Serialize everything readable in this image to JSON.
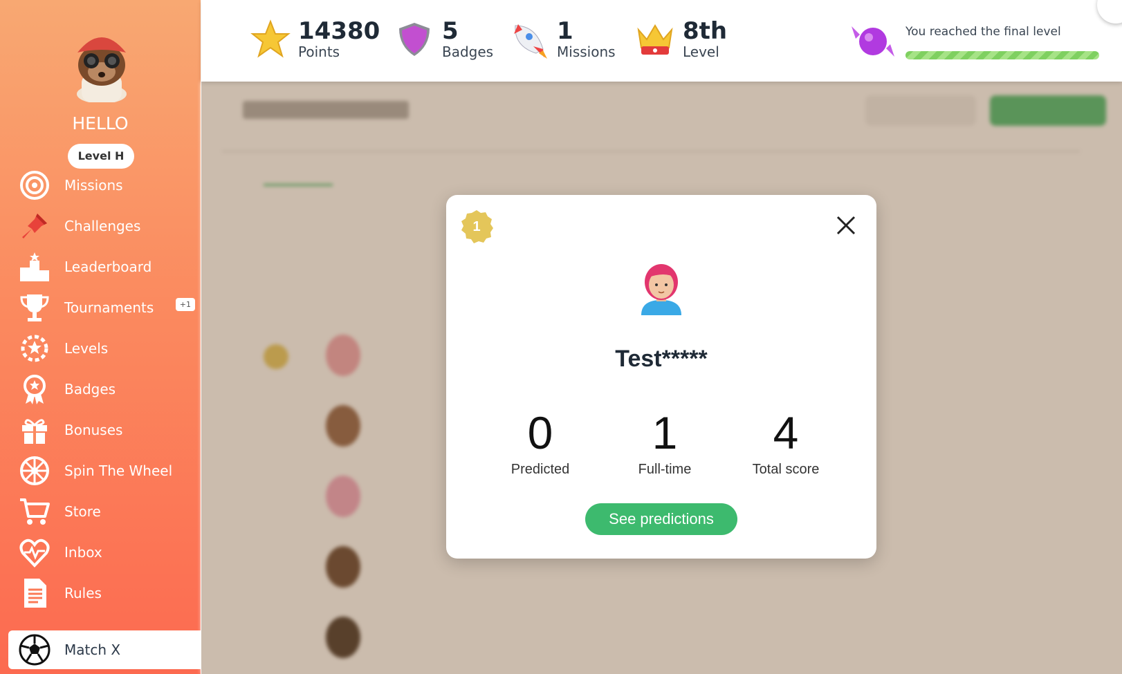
{
  "sidebar": {
    "greeting": "HELLO",
    "level": "Level H",
    "items": [
      {
        "label": "Missions",
        "icon": "target-icon"
      },
      {
        "label": "Challenges",
        "icon": "pin-icon"
      },
      {
        "label": "Leaderboard",
        "icon": "podium-icon"
      },
      {
        "label": "Tournaments",
        "icon": "trophy-icon",
        "badge": "+1"
      },
      {
        "label": "Levels",
        "icon": "star-gear-icon"
      },
      {
        "label": "Badges",
        "icon": "badge-ribbon-icon"
      },
      {
        "label": "Bonuses",
        "icon": "gift-icon"
      },
      {
        "label": "Spin The Wheel",
        "icon": "wheel-icon"
      },
      {
        "label": "Store",
        "icon": "cart-icon"
      },
      {
        "label": "Inbox",
        "icon": "heart-pulse-icon"
      },
      {
        "label": "Rules",
        "icon": "document-icon"
      },
      {
        "label": "Match X",
        "icon": "soccer-ball-icon",
        "active": true
      }
    ]
  },
  "stats": {
    "points": {
      "value": "14380",
      "label": "Points"
    },
    "badges": {
      "value": "5",
      "label": "Badges"
    },
    "missions": {
      "value": "1",
      "label": "Missions"
    },
    "level": {
      "value": "8th",
      "label": "Level"
    }
  },
  "progress": {
    "text": "You reached the final level",
    "fraction": 1.0
  },
  "modal": {
    "rank": "1",
    "player_name": "Test*****",
    "scores": [
      {
        "value": "0",
        "caption": "Predicted"
      },
      {
        "value": "1",
        "caption": "Full-time"
      },
      {
        "value": "4",
        "caption": "Total score"
      }
    ],
    "button": "See predictions"
  },
  "colors": {
    "sidebar_top": "#f8a872",
    "sidebar_bottom": "#fc6a50",
    "accent_green": "#3dba6e",
    "rank_gold": "#e4c65a"
  }
}
